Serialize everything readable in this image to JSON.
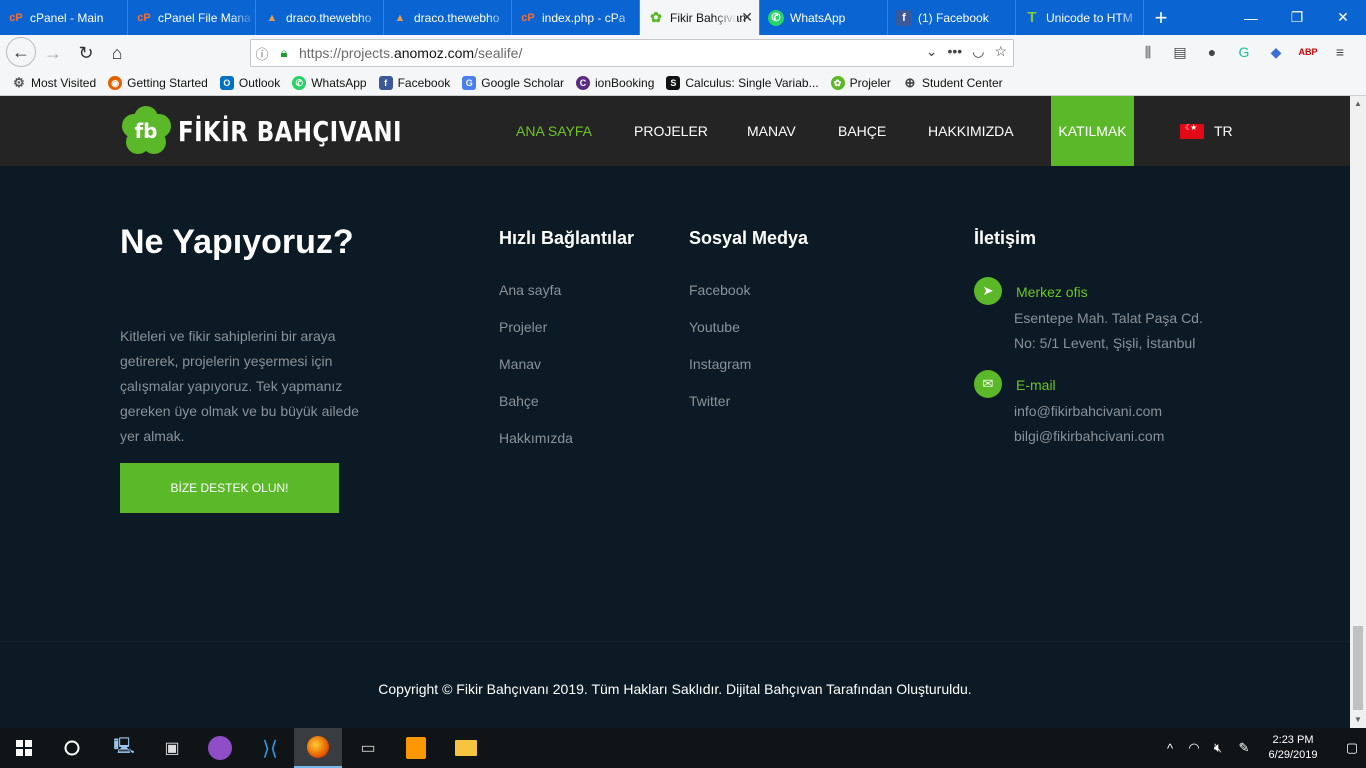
{
  "browser": {
    "tabs": [
      {
        "label": "cPanel - Main",
        "icon": "cpanel-icon",
        "color": "#ff6c2c",
        "glyph": "cP"
      },
      {
        "label": "cPanel File Mana",
        "icon": "cpanel-icon",
        "color": "#ff6c2c",
        "glyph": "cP"
      },
      {
        "label": "draco.thewebho",
        "icon": "draco-icon",
        "color": "#d08a2a",
        "glyph": "▲"
      },
      {
        "label": "draco.thewebho",
        "icon": "draco-icon",
        "color": "#d08a2a",
        "glyph": "▲"
      },
      {
        "label": "index.php - cPa",
        "icon": "cpanel-icon",
        "color": "#ff6c2c",
        "glyph": "cP"
      },
      {
        "label": "Fikir Bahçıvan",
        "icon": "fikir-icon",
        "color": "#5bb829",
        "glyph": "✿",
        "active": true
      },
      {
        "label": "WhatsApp",
        "icon": "whatsapp-icon",
        "color": "#25d366",
        "glyph": "✆"
      },
      {
        "label": "(1) Facebook",
        "icon": "facebook-icon",
        "color": "#3b5998",
        "glyph": "f"
      },
      {
        "label": "Unicode to HTM",
        "icon": "unicode-icon",
        "color": "#8cc63f",
        "glyph": "T"
      }
    ],
    "url_prefix": "https://projects.",
    "url_domain": "anomoz.com",
    "url_path": "/sealife/",
    "bookmarks": [
      {
        "label": "Most Visited",
        "icon": "gear-icon",
        "color": "#555555",
        "glyph": "⚙"
      },
      {
        "label": "Getting Started",
        "icon": "firefox-icon",
        "color": "#e66000",
        "glyph": "◉"
      },
      {
        "label": "Outlook",
        "icon": "outlook-icon",
        "color": "#0072c6",
        "glyph": "O"
      },
      {
        "label": "WhatsApp",
        "icon": "whatsapp-icon",
        "color": "#25d366",
        "glyph": "✆"
      },
      {
        "label": "Facebook",
        "icon": "facebook-icon",
        "color": "#3b5998",
        "glyph": "f"
      },
      {
        "label": "Google Scholar",
        "icon": "scholar-icon",
        "color": "#4a7ef0",
        "glyph": "G"
      },
      {
        "label": "ionBooking",
        "icon": "ionbooking-icon",
        "color": "#5a2d82",
        "glyph": "C"
      },
      {
        "label": "Calculus: Single Variab...",
        "icon": "calculus-icon",
        "color": "#111111",
        "glyph": "S"
      },
      {
        "label": "Projeler",
        "icon": "projeler-icon",
        "color": "#5bb829",
        "glyph": "✿"
      },
      {
        "label": "Student Center",
        "icon": "globe-icon",
        "color": "#444444",
        "glyph": "⊕"
      }
    ]
  },
  "site": {
    "logo_text": "FİKİR BAHÇIVANI",
    "logo_mark": "fb",
    "menu": [
      {
        "label": "ANA SAYFA",
        "active": true
      },
      {
        "label": "PROJELER"
      },
      {
        "label": "MANAV"
      },
      {
        "label": "BAHÇE"
      },
      {
        "label": "HAKKIMIZDA"
      },
      {
        "label": "KATILMAK",
        "highlight": true
      }
    ],
    "language": "TR"
  },
  "footer": {
    "about_title": "Ne Yapıyoruz?",
    "about_text": "Kitleleri ve fikir sahiplerini bir araya getirerek, projelerin yeşermesi için çalışmalar yapıyoruz. Tek yapmanız gereken üye olmak ve bu büyük ailede yer almak.",
    "support_button": "BİZE DESTEK OLUN!",
    "quick_links_title": "Hızlı Bağlantılar",
    "quick_links": [
      "Ana sayfa",
      "Projeler",
      "Manav",
      "Bahçe",
      "Hakkımızda"
    ],
    "social_title": "Sosyal Medya",
    "social_links": [
      "Facebook",
      "Youtube",
      "Instagram",
      "Twitter"
    ],
    "contact_title": "İletişim",
    "office_label": "Merkez ofis",
    "address_lines": [
      "Esentepe Mah. Talat Paşa Cd.",
      "No: 5/1 Levent, Şişli, İstanbul"
    ],
    "email_label": "E-mail",
    "emails": [
      "info@fikirbahcivani.com",
      "bilgi@fikirbahcivani.com"
    ],
    "copyright": "Copyright © Fikir Bahçıvanı 2019. Tüm Hakları Saklıdır. Dijital Bahçıvan Tarafından Oluşturuldu."
  },
  "taskbar": {
    "time": "2:23 PM",
    "date": "6/29/2019"
  },
  "colors": {
    "accent": "#5bb829",
    "header_bg": "#242424",
    "footer_bg": "#0b1a24",
    "browser_blue": "#0a64d2"
  }
}
